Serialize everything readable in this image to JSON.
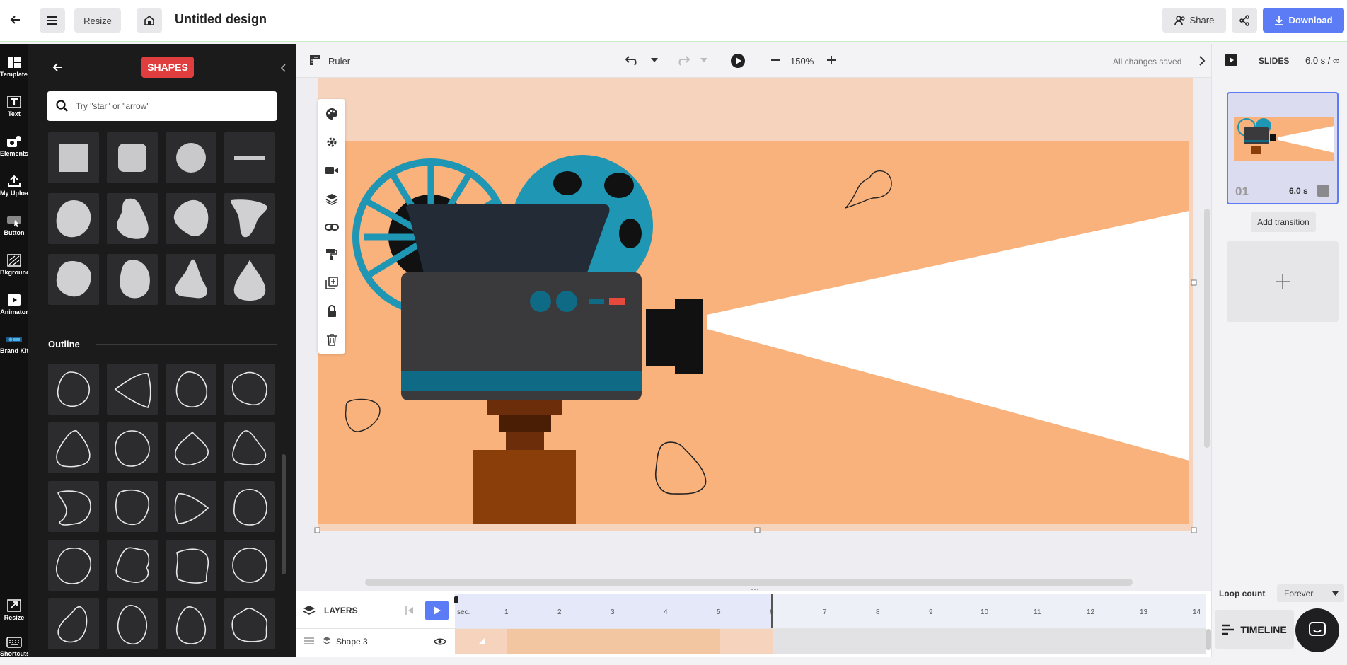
{
  "header": {
    "resize_label": "Resize",
    "title": "Untitled design",
    "share_label": "Share",
    "download_label": "Download"
  },
  "rail": {
    "items": [
      {
        "label": "Templates"
      },
      {
        "label": "Text"
      },
      {
        "label": "Elements"
      },
      {
        "label": "My Uploads"
      },
      {
        "label": "Button"
      },
      {
        "label": "Bkground"
      },
      {
        "label": "Animator"
      },
      {
        "label": "Brand Kit"
      },
      {
        "label": "Resize"
      },
      {
        "label": "Shortcuts"
      }
    ]
  },
  "panel": {
    "tag": "SHAPES",
    "search_placeholder": "Try \"star\" or \"arrow\"",
    "outline_section": "Outline"
  },
  "editor": {
    "ruler_label": "Ruler",
    "zoom": "150%",
    "save_status": "All changes saved"
  },
  "slides": {
    "header": "SLIDES",
    "duration": "6.0 s / ∞",
    "slide_number": "01",
    "slide_time": "6.0 s",
    "add_transition": "Add transition",
    "loop_label": "Loop count",
    "loop_value": "Forever",
    "timeline_label": "TIMELINE"
  },
  "timeline": {
    "layers_label": "LAYERS",
    "sec_label": "sec.",
    "ticks": [
      "1",
      "2",
      "3",
      "4",
      "5",
      "6",
      "7",
      "8",
      "9",
      "10",
      "11",
      "12",
      "13",
      "14"
    ],
    "layer_name": "Shape 3"
  },
  "colors": {
    "accent": "#5b7cf5",
    "shapes_tag": "#e03e3e",
    "canvas_bg": "#f9b27c",
    "canvas_top": "#f5d3bd",
    "reel": "#1e96b4",
    "projector_dark": "#222b36",
    "projector_body": "#3a3a3c",
    "stand": "#8a3e0a"
  }
}
